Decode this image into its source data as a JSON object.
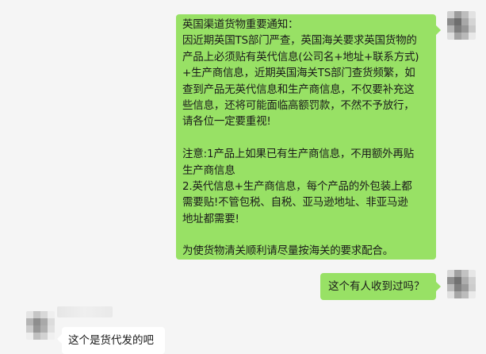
{
  "messages": {
    "notice": {
      "lines": [
        "英国渠道货物重要通知：",
        "因近期英国TS部门严查，英国海关要求英国货物的",
        "产品上必须贴有英代信息(公司名+地址+联系方式)",
        "+生产商信息，近期英国海关TS部门查货频繁，如",
        "查到产品无英代信息和生产商信息，不仅要补充这",
        "些信息，还将可能面临高额罚款，不然不予放行，",
        "请各位一定要重视!",
        "",
        "注意:1产品上如果已有生产商信息，不用额外再贴",
        "生产商信息",
        "2.英代信息+生产商信息，每个产品的外包装上都",
        "需要贴!不管包税、自税、亚马逊地址、非亚马逊",
        "地址都需要!",
        "",
        "为使货物清关顺利请尽量按海关的要求配合。"
      ]
    },
    "question": {
      "text": "这个有人收到过吗？"
    },
    "reply": {
      "text": "这个是货代发的吧"
    }
  },
  "colors": {
    "background": "#f5f5f5",
    "self_bubble": "#98e165",
    "other_bubble": "#ffffff"
  }
}
